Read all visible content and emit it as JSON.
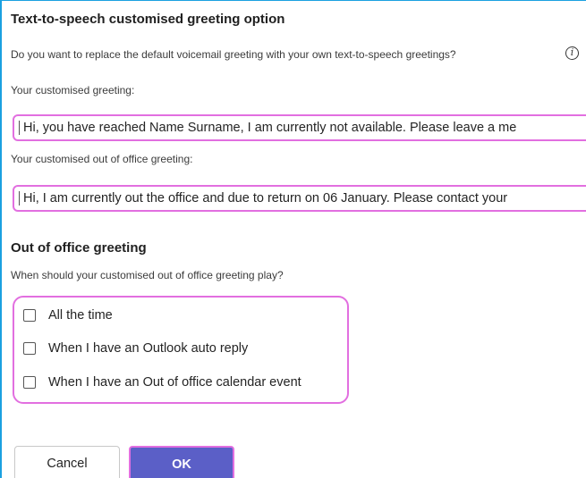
{
  "tts_section": {
    "heading": "Text-to-speech customised greeting option",
    "question": "Do you want to replace the default voicemail greeting with your own text-to-speech greetings?",
    "info_icon": "info-icon",
    "greeting_label": "Your customised greeting:",
    "greeting_value": "Hi, you have reached Name Surname, I am currently not available. Please leave a me",
    "ooo_label": "Your customised out of office greeting:",
    "ooo_value": "Hi, I am currently out the office and due to return on 06 January. Please contact your"
  },
  "ooo_section": {
    "heading": "Out of office greeting",
    "question": "When should your customised out of office greeting play?",
    "options": [
      {
        "label": "All the time",
        "checked": false
      },
      {
        "label": "When I have an Outlook auto reply",
        "checked": false
      },
      {
        "label": "When I have an Out of office calendar event",
        "checked": false
      }
    ]
  },
  "buttons": {
    "cancel": "Cancel",
    "ok": "OK"
  },
  "colors": {
    "accent": "#5b5fc7",
    "highlight": "#e26fe0",
    "frame": "#1aa0e0"
  }
}
